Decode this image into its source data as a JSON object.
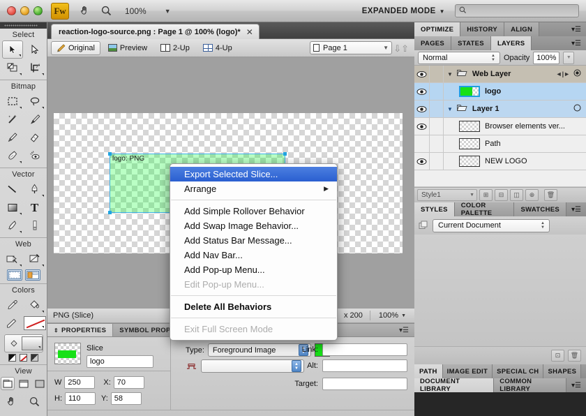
{
  "window": {
    "app_badge": "Fw",
    "zoom_level": "100%",
    "mode_label": "EXPANDED MODE",
    "search_placeholder": ""
  },
  "document_tab": {
    "title": "reaction-logo-source.png : Page 1 @ 100% (logo)*",
    "close_label": "✕"
  },
  "view_bar": {
    "buttons": [
      {
        "label": "Original",
        "icon": "pencil-icon",
        "active": true
      },
      {
        "label": "Preview",
        "icon": "image-icon",
        "active": false
      },
      {
        "label": "2-Up",
        "icon": "two-up-icon",
        "active": false
      },
      {
        "label": "4-Up",
        "icon": "four-up-icon",
        "active": false
      }
    ],
    "page_selector": "Page 1"
  },
  "toolbox": {
    "groups": [
      {
        "title": "Select",
        "tools": [
          {
            "name": "pointer-tool",
            "selected": true
          },
          {
            "name": "subselection-tool",
            "selected": false
          },
          {
            "name": "scale-tool",
            "selected": false
          },
          {
            "name": "crop-tool",
            "selected": false
          }
        ]
      },
      {
        "title": "Bitmap",
        "tools": [
          {
            "name": "marquee-tool",
            "selected": false
          },
          {
            "name": "lasso-tool",
            "selected": false
          },
          {
            "name": "magic-wand-tool",
            "selected": false
          },
          {
            "name": "brush-tool",
            "selected": false
          },
          {
            "name": "pencil-tool",
            "selected": false
          },
          {
            "name": "eraser-tool",
            "selected": false
          },
          {
            "name": "blur-tool",
            "selected": false
          },
          {
            "name": "rubber-stamp-tool",
            "selected": false
          }
        ]
      },
      {
        "title": "Vector",
        "tools": [
          {
            "name": "line-tool",
            "selected": false
          },
          {
            "name": "pen-tool",
            "selected": false
          },
          {
            "name": "rectangle-tool",
            "selected": false
          },
          {
            "name": "text-tool",
            "selected": false
          },
          {
            "name": "freeform-tool",
            "selected": false
          },
          {
            "name": "knife-tool",
            "selected": false
          }
        ]
      },
      {
        "title": "Web",
        "tools": [
          {
            "name": "hotspot-tool",
            "selected": false
          },
          {
            "name": "slice-tool",
            "selected": false
          },
          {
            "name": "hide-slices-button",
            "selected": false
          },
          {
            "name": "show-slices-button",
            "selected": false
          }
        ]
      },
      {
        "title": "Colors",
        "tools": [
          {
            "name": "eyedropper-tool",
            "selected": false
          },
          {
            "name": "paint-bucket-tool",
            "selected": false
          },
          {
            "name": "stroke-color-well",
            "selected": false
          },
          {
            "name": "fill-color-well",
            "selected": false
          }
        ]
      },
      {
        "title": "View",
        "tools": [
          {
            "name": "standard-screen-mode",
            "selected": true
          },
          {
            "name": "full-screen-menu-mode",
            "selected": false
          },
          {
            "name": "full-screen-mode",
            "selected": false
          },
          {
            "name": "hand-tool",
            "selected": false
          },
          {
            "name": "zoom-tool",
            "selected": false
          }
        ]
      }
    ]
  },
  "canvas": {
    "slice_label": "logo: PNG"
  },
  "status_bar": {
    "object_type": "PNG (Slice)",
    "dimensions": "x 200",
    "zoom": "100%"
  },
  "properties": {
    "tabs": [
      {
        "label": "PROPERTIES",
        "active": true
      },
      {
        "label": "SYMBOL PROPERTIES",
        "active": false
      }
    ],
    "object_kind": "Slice",
    "name_value": "logo",
    "w_label": "W",
    "w_value": "250",
    "h_label": "H:",
    "h_value": "110",
    "x_label": "X:",
    "x_value": "70",
    "y_label": "Y:",
    "y_value": "58",
    "type_label": "Type:",
    "type_value": "Foreground Image",
    "slice_color": "#17e017",
    "link_label": "Link:",
    "link_value": "",
    "alt_label": "Alt:",
    "alt_value": "",
    "target_label": "Target:",
    "target_value": ""
  },
  "context_menu": {
    "items": [
      {
        "label": "Export Selected Slice...",
        "highlighted": true,
        "disabled": false,
        "submenu": false
      },
      {
        "label": "Arrange",
        "highlighted": false,
        "disabled": false,
        "submenu": true
      },
      {
        "separator": true
      },
      {
        "label": "Add Simple Rollover Behavior",
        "highlighted": false,
        "disabled": false,
        "submenu": false
      },
      {
        "label": "Add Swap Image Behavior...",
        "highlighted": false,
        "disabled": false,
        "submenu": false
      },
      {
        "label": "Add Status Bar Message...",
        "highlighted": false,
        "disabled": false,
        "submenu": false
      },
      {
        "label": "Add Nav Bar...",
        "highlighted": false,
        "disabled": false,
        "submenu": false
      },
      {
        "label": "Add Pop-up Menu...",
        "highlighted": false,
        "disabled": false,
        "submenu": false
      },
      {
        "label": "Edit Pop-up Menu...",
        "highlighted": false,
        "disabled": true,
        "submenu": false
      },
      {
        "separator": true
      },
      {
        "label": "Delete All Behaviors",
        "highlighted": false,
        "disabled": false,
        "submenu": false
      },
      {
        "separator": true
      },
      {
        "label": "Exit Full Screen Mode",
        "highlighted": false,
        "disabled": true,
        "submenu": false
      }
    ]
  },
  "dock": {
    "top_group_tabs": [
      {
        "label": "OPTIMIZE",
        "active": true
      },
      {
        "label": "HISTORY",
        "active": false
      },
      {
        "label": "ALIGN",
        "active": false
      }
    ],
    "layers_tabs": [
      {
        "label": "PAGES",
        "active": false
      },
      {
        "label": "STATES",
        "active": false
      },
      {
        "label": "LAYERS",
        "active": true
      }
    ],
    "blend_mode": "Normal",
    "opacity_label": "Opacity",
    "opacity_value": "100%",
    "layers": [
      {
        "name": "Web Layer",
        "kind": "group",
        "visible": true,
        "locked": false,
        "selected": false,
        "expanded": true
      },
      {
        "name": "logo",
        "kind": "slice",
        "visible": true,
        "locked": false,
        "selected": true,
        "expanded": false
      },
      {
        "name": "Layer 1",
        "kind": "group2",
        "visible": true,
        "locked": false,
        "selected": false,
        "expanded": true
      },
      {
        "name": "Browser elements ver...",
        "kind": "object",
        "visible": true,
        "locked": false,
        "selected": false,
        "expanded": false
      },
      {
        "name": "Path",
        "kind": "object",
        "visible": false,
        "locked": false,
        "selected": false,
        "expanded": false
      },
      {
        "name": "NEW LOGO",
        "kind": "object",
        "visible": true,
        "locked": false,
        "selected": false,
        "expanded": false
      }
    ],
    "style_selector": "Style1",
    "styles_tabs": [
      {
        "label": "STYLES",
        "active": true
      },
      {
        "label": "COLOR PALETTE",
        "active": false
      },
      {
        "label": "SWATCHES",
        "active": false
      }
    ],
    "styles_document": "Current Document",
    "path_tabs": [
      {
        "label": "PATH",
        "active": true
      },
      {
        "label": "IMAGE EDIT",
        "active": false
      },
      {
        "label": "SPECIAL CH",
        "active": false
      },
      {
        "label": "SHAPES",
        "active": false
      }
    ],
    "library_tabs": [
      {
        "label": "DOCUMENT LIBRARY",
        "active": true
      },
      {
        "label": "COMMON LIBRARY",
        "active": false
      }
    ]
  }
}
